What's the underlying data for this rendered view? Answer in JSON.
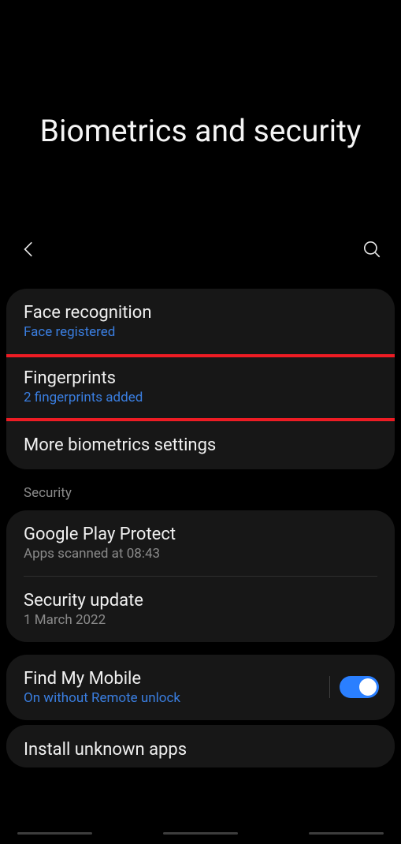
{
  "pageTitle": "Biometrics and security",
  "biometrics": {
    "face": {
      "title": "Face recognition",
      "subtitle": "Face registered"
    },
    "fingerprints": {
      "title": "Fingerprints",
      "subtitle": "2 fingerprints added"
    },
    "more": {
      "title": "More biometrics settings"
    }
  },
  "securityHeader": "Security",
  "security": {
    "playProtect": {
      "title": "Google Play Protect",
      "subtitle": "Apps scanned at 08:43"
    },
    "update": {
      "title": "Security update",
      "subtitle": "1 March 2022"
    }
  },
  "findMyMobile": {
    "title": "Find My Mobile",
    "subtitle": "On without Remote unlock",
    "toggled": true
  },
  "installUnknown": {
    "title": "Install unknown apps"
  }
}
